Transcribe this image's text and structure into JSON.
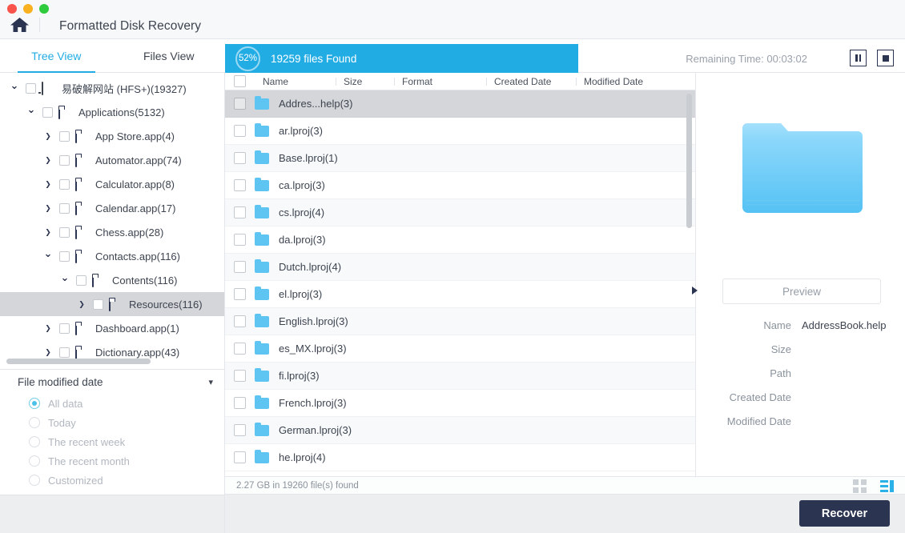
{
  "window": {
    "title": "Formatted Disk Recovery",
    "home_icon": "home-icon",
    "traffic_lights": [
      "close",
      "minimize",
      "zoom"
    ]
  },
  "tabs": [
    {
      "label": "Tree View",
      "active": true
    },
    {
      "label": "Files View",
      "active": false
    }
  ],
  "scan": {
    "percent_label": "52%",
    "percent_value": 52,
    "found_label": "19259 files Found",
    "remaining_label": "Remaining Time: 00:03:02",
    "pause_icon": "pause-icon",
    "stop_icon": "stop-icon",
    "accent_color": "#22ace4"
  },
  "tree": [
    {
      "label": "易破解网站 (HFS+)(19327)",
      "indent": 0,
      "twisty": "⌄",
      "icon": "disk-icon",
      "selected": false
    },
    {
      "label": "Applications(5132)",
      "indent": 1,
      "twisty": "⌄",
      "icon": "folder-icon",
      "selected": false
    },
    {
      "label": "App Store.app(4)",
      "indent": 2,
      "twisty": "❯",
      "icon": "folder-icon",
      "selected": false
    },
    {
      "label": "Automator.app(74)",
      "indent": 2,
      "twisty": "❯",
      "icon": "folder-icon",
      "selected": false
    },
    {
      "label": "Calculator.app(8)",
      "indent": 2,
      "twisty": "❯",
      "icon": "folder-icon",
      "selected": false
    },
    {
      "label": "Calendar.app(17)",
      "indent": 2,
      "twisty": "❯",
      "icon": "folder-icon",
      "selected": false
    },
    {
      "label": "Chess.app(28)",
      "indent": 2,
      "twisty": "❯",
      "icon": "folder-icon",
      "selected": false
    },
    {
      "label": "Contacts.app(116)",
      "indent": 2,
      "twisty": "⌄",
      "icon": "folder-icon",
      "selected": false
    },
    {
      "label": "Contents(116)",
      "indent": 3,
      "twisty": "⌄",
      "icon": "folder-icon",
      "selected": false
    },
    {
      "label": "Resources(116)",
      "indent": 4,
      "twisty": "❯",
      "icon": "folder-icon",
      "selected": true
    },
    {
      "label": "Dashboard.app(1)",
      "indent": 2,
      "twisty": "❯",
      "icon": "folder-icon",
      "selected": false
    },
    {
      "label": "Dictionary.app(43)",
      "indent": 2,
      "twisty": "❯",
      "icon": "folder-icon",
      "selected": false
    }
  ],
  "filter": {
    "title": "File modified date",
    "chevron_icon": "chevron-down-icon",
    "options": [
      {
        "label": "All data",
        "selected": true
      },
      {
        "label": "Today",
        "selected": false
      },
      {
        "label": "The recent week",
        "selected": false
      },
      {
        "label": "The recent month",
        "selected": false
      },
      {
        "label": "Customized",
        "selected": false
      }
    ]
  },
  "filelist": {
    "columns": [
      "Name",
      "Size",
      "Format",
      "Created Date",
      "Modified Date"
    ],
    "rows": [
      {
        "name": "Addres...help(3)",
        "size": "",
        "format": "",
        "created": "",
        "modified": "",
        "selected": true
      },
      {
        "name": "ar.lproj(3)",
        "size": "",
        "format": "",
        "created": "",
        "modified": "",
        "selected": false
      },
      {
        "name": "Base.lproj(1)",
        "size": "",
        "format": "",
        "created": "",
        "modified": "",
        "selected": false
      },
      {
        "name": "ca.lproj(3)",
        "size": "",
        "format": "",
        "created": "",
        "modified": "",
        "selected": false
      },
      {
        "name": "cs.lproj(4)",
        "size": "",
        "format": "",
        "created": "",
        "modified": "",
        "selected": false
      },
      {
        "name": "da.lproj(3)",
        "size": "",
        "format": "",
        "created": "",
        "modified": "",
        "selected": false
      },
      {
        "name": "Dutch.lproj(4)",
        "size": "",
        "format": "",
        "created": "",
        "modified": "",
        "selected": false
      },
      {
        "name": "el.lproj(3)",
        "size": "",
        "format": "",
        "created": "",
        "modified": "",
        "selected": false
      },
      {
        "name": "English.lproj(3)",
        "size": "",
        "format": "",
        "created": "",
        "modified": "",
        "selected": false
      },
      {
        "name": "es_MX.lproj(3)",
        "size": "",
        "format": "",
        "created": "",
        "modified": "",
        "selected": false
      },
      {
        "name": "fi.lproj(3)",
        "size": "",
        "format": "",
        "created": "",
        "modified": "",
        "selected": false
      },
      {
        "name": "French.lproj(3)",
        "size": "",
        "format": "",
        "created": "",
        "modified": "",
        "selected": false
      },
      {
        "name": "German.lproj(3)",
        "size": "",
        "format": "",
        "created": "",
        "modified": "",
        "selected": false
      },
      {
        "name": "he.lproj(4)",
        "size": "",
        "format": "",
        "created": "",
        "modified": "",
        "selected": false
      }
    ]
  },
  "preview": {
    "folder_icon": "folder-large-icon",
    "button_label": "Preview",
    "fields": [
      {
        "key": "Name",
        "value": "AddressBook.help"
      },
      {
        "key": "Size",
        "value": ""
      },
      {
        "key": "Path",
        "value": ""
      },
      {
        "key": "Created Date",
        "value": ""
      },
      {
        "key": "Modified Date",
        "value": ""
      }
    ]
  },
  "statusbar": {
    "text": "2.27 GB in 19260 file(s) found",
    "grid_view_icon": "grid-view-icon",
    "list_view_icon": "list-view-icon",
    "active_view": "list"
  },
  "footer": {
    "recover_label": "Recover",
    "recover_color": "#2b3450"
  }
}
